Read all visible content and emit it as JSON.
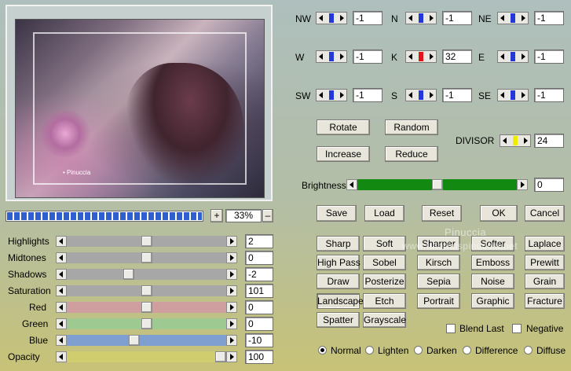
{
  "matrix": {
    "rows": [
      [
        {
          "label": "NW",
          "value": "-1"
        },
        {
          "label": "N",
          "value": "-1"
        },
        {
          "label": "NE",
          "value": "-1"
        }
      ],
      [
        {
          "label": "W",
          "value": "-1"
        },
        {
          "label": "K",
          "value": "32"
        },
        {
          "label": "E",
          "value": "-1"
        }
      ],
      [
        {
          "label": "SW",
          "value": "-1"
        },
        {
          "label": "S",
          "value": "-1"
        },
        {
          "label": "SE",
          "value": "-1"
        }
      ]
    ],
    "k_color": "#e0141a",
    "thumb_color": "#2437d8"
  },
  "actions": {
    "rotate": "Rotate",
    "random": "Random",
    "increase": "Increase",
    "reduce": "Reduce"
  },
  "divisor": {
    "label": "DIVISOR",
    "value": "24",
    "thumb_color": "#f2ec00"
  },
  "brightness": {
    "label": "Brightness",
    "value": "0",
    "level": 0.5,
    "fill_color": "#128a12"
  },
  "file": {
    "save": "Save",
    "load": "Load",
    "reset": "Reset",
    "ok": "OK",
    "cancel": "Cancel"
  },
  "zoom": {
    "value": "33%",
    "plus": "+",
    "minus": "–",
    "progress": 1.0
  },
  "adjustments": [
    {
      "label": "Highlights",
      "value": "2",
      "level": 0.5,
      "track": "#a7a7a7"
    },
    {
      "label": "Midtones",
      "value": "0",
      "level": 0.5,
      "track": "#a7a7a7"
    },
    {
      "label": "Shadows",
      "value": "-2",
      "level": 0.38,
      "track": "#a7a7a7"
    },
    {
      "label": "Saturation",
      "value": "101",
      "level": 0.5,
      "track": "#a7a7a7"
    },
    {
      "label": "Red",
      "value": "0",
      "level": 0.5,
      "track": "#cf9f9f"
    },
    {
      "label": "Green",
      "value": "0",
      "level": 0.5,
      "track": "#9ec991"
    },
    {
      "label": "Blue",
      "value": "-10",
      "level": 0.42,
      "track": "#7e9fd0"
    },
    {
      "label": "Opacity",
      "value": "100",
      "level": 1.0,
      "track": "#cfcd6e"
    }
  ],
  "presets": [
    [
      "Sharp",
      "Soft",
      "Sharper",
      "Softer",
      "Laplace"
    ],
    [
      "High Pass",
      "Sobel",
      "Kirsch",
      "Emboss",
      "Prewitt"
    ],
    [
      "Draw",
      "Posterize",
      "Sepia",
      "Noise",
      "Grain"
    ],
    [
      "Landscape",
      "Etch",
      "Portrait",
      "Graphic",
      "Fracture"
    ],
    [
      "Spatter",
      "Grayscale"
    ]
  ],
  "active_preset": "Landscape",
  "options": {
    "blend_last": "Blend Last",
    "negative": "Negative"
  },
  "modes": [
    "Normal",
    "Lighten",
    "Darken",
    "Difference",
    "Diffuse"
  ],
  "active_mode": "Normal",
  "watermark": {
    "line1": "Pinuccia",
    "line2": "www.tutorialspinuccia.net"
  },
  "preview_caption": "• Pinuccia"
}
